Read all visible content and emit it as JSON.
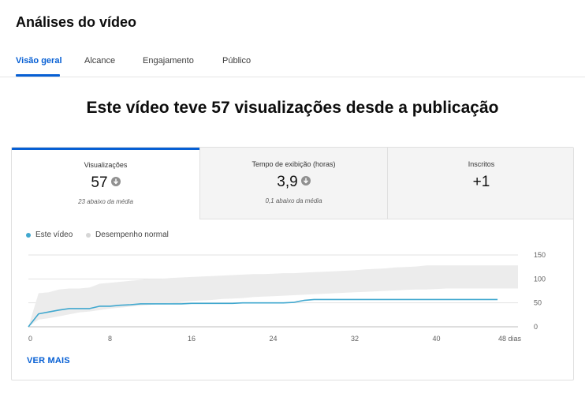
{
  "page": {
    "title": "Análises do vídeo",
    "tabs": [
      "Visão geral",
      "Alcance",
      "Engajamento",
      "Público"
    ],
    "headline": "Este vídeo teve 57 visualizações desde a publicação"
  },
  "metrics": [
    {
      "label": "Visualizações",
      "value": "57",
      "sub": "23 abaixo da média",
      "trend_icon": "arrow-down-circle-icon"
    },
    {
      "label": "Tempo de exibição (horas)",
      "value": "3,9",
      "sub": "0,1 abaixo da média",
      "trend_icon": "arrow-down-circle-icon"
    },
    {
      "label": "Inscritos",
      "value": "+1",
      "sub": ""
    }
  ],
  "legend": {
    "series": "Este vídeo",
    "band": "Desempenho normal"
  },
  "see_more": "VER MAIS",
  "colors": {
    "accent": "#065fd4",
    "series": "#41a8cf",
    "band": "#ececec",
    "arrow": "#909090"
  },
  "chart_data": {
    "type": "line",
    "xlabel": "",
    "ylabel": "",
    "x_ticks": [
      0,
      8,
      16,
      24,
      32,
      40,
      48
    ],
    "x_tick_labels": [
      "0",
      "8",
      "16",
      "24",
      "32",
      "40",
      "48 dias"
    ],
    "y_ticks": [
      0,
      50,
      100,
      150
    ],
    "xlim": [
      0,
      48
    ],
    "ylim": [
      0,
      150
    ],
    "grid": true,
    "legend_position": "top-left",
    "series": [
      {
        "name": "Este vídeo",
        "x": [
          0,
          1,
          2,
          3,
          4,
          5,
          6,
          7,
          8,
          9,
          10,
          11,
          12,
          13,
          14,
          15,
          16,
          17,
          18,
          19,
          20,
          21,
          22,
          23,
          24,
          25,
          26,
          27,
          28,
          29,
          30,
          31,
          32,
          33,
          34,
          35,
          36,
          37,
          38,
          39,
          40,
          41,
          42,
          43,
          44,
          45,
          46
        ],
        "y": [
          0,
          27,
          31,
          35,
          38,
          38,
          38,
          43,
          43,
          45,
          46,
          48,
          48,
          48,
          48,
          48,
          49,
          49,
          49,
          49,
          49,
          50,
          50,
          50,
          50,
          50,
          51,
          55,
          57,
          57,
          57,
          57,
          57,
          57,
          57,
          57,
          57,
          57,
          57,
          57,
          57,
          57,
          57,
          57,
          57,
          57,
          57
        ]
      }
    ],
    "bands": [
      {
        "name": "Desempenho normal",
        "x": [
          0,
          1,
          2,
          3,
          4,
          5,
          6,
          7,
          8,
          9,
          10,
          11,
          12,
          13,
          14,
          15,
          16,
          17,
          18,
          19,
          20,
          21,
          22,
          23,
          24,
          25,
          26,
          27,
          28,
          29,
          30,
          31,
          32,
          33,
          34,
          35,
          36,
          37,
          38,
          39,
          40,
          41,
          42,
          43,
          44,
          45,
          46,
          47,
          48
        ],
        "low": [
          0,
          15,
          18,
          22,
          26,
          30,
          32,
          35,
          38,
          40,
          42,
          44,
          46,
          48,
          50,
          52,
          54,
          55,
          56,
          58,
          59,
          60,
          62,
          63,
          64,
          65,
          66,
          67,
          68,
          69,
          70,
          71,
          72,
          73,
          74,
          75,
          76,
          77,
          78,
          78,
          79,
          80,
          80,
          80,
          80,
          80,
          80,
          80,
          80
        ],
        "high": [
          0,
          70,
          72,
          78,
          80,
          80,
          82,
          90,
          92,
          94,
          96,
          98,
          100,
          100,
          102,
          103,
          104,
          105,
          106,
          107,
          108,
          109,
          110,
          110,
          111,
          112,
          112,
          113,
          114,
          115,
          116,
          117,
          118,
          120,
          121,
          122,
          124,
          125,
          126,
          128,
          128,
          128,
          128,
          128,
          128,
          128,
          128,
          128,
          128
        ]
      }
    ]
  }
}
